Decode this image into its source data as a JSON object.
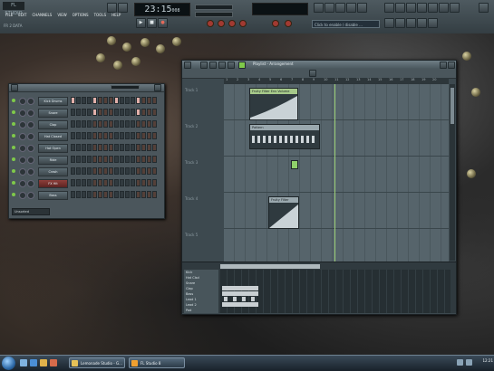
{
  "topbar": {
    "logo": "FL STUDIO",
    "menu": [
      "FILE",
      "EDIT",
      "CHANNELS",
      "VIEW",
      "OPTIONS",
      "TOOLS",
      "HELP"
    ],
    "hint": "FR 2 DATA",
    "clock": "23:15",
    "clock_sub": "008",
    "hint_bar": "Click to enable / disable ...",
    "transport": {
      "play": "▶",
      "stop": "■",
      "record": "●"
    }
  },
  "stepseq": {
    "channels": [
      {
        "name": "Kick Drums",
        "red": false,
        "steps": [
          1,
          0,
          0,
          0,
          1,
          0,
          0,
          0,
          1,
          0,
          0,
          0,
          1,
          0,
          0,
          0
        ]
      },
      {
        "name": "Snare",
        "red": false,
        "steps": [
          0,
          0,
          0,
          0,
          1,
          0,
          0,
          0,
          0,
          0,
          0,
          0,
          1,
          0,
          0,
          0
        ]
      },
      {
        "name": "Clap",
        "red": false,
        "steps": [
          0,
          0,
          0,
          0,
          0,
          0,
          0,
          0,
          0,
          0,
          0,
          0,
          0,
          0,
          0,
          0
        ]
      },
      {
        "name": "Hat Closed",
        "red": false,
        "steps": [
          0,
          0,
          0,
          0,
          0,
          0,
          0,
          0,
          0,
          0,
          0,
          0,
          0,
          0,
          0,
          0
        ]
      },
      {
        "name": "Hat Open",
        "red": false,
        "steps": [
          0,
          0,
          0,
          0,
          0,
          0,
          0,
          0,
          0,
          0,
          0,
          0,
          0,
          0,
          0,
          0
        ]
      },
      {
        "name": "Ride",
        "red": false,
        "steps": [
          0,
          0,
          0,
          0,
          0,
          0,
          0,
          0,
          0,
          0,
          0,
          0,
          0,
          0,
          0,
          0
        ]
      },
      {
        "name": "Crash",
        "red": false,
        "steps": [
          0,
          0,
          0,
          0,
          0,
          0,
          0,
          0,
          0,
          0,
          0,
          0,
          0,
          0,
          0,
          0
        ]
      },
      {
        "name": "FX Hit",
        "red": true,
        "steps": [
          0,
          0,
          0,
          0,
          0,
          0,
          0,
          0,
          0,
          0,
          0,
          0,
          0,
          0,
          0,
          0
        ]
      },
      {
        "name": "Bass",
        "red": false,
        "steps": [
          0,
          0,
          0,
          0,
          0,
          0,
          0,
          0,
          0,
          0,
          0,
          0,
          0,
          0,
          0,
          0
        ]
      }
    ],
    "footer": "Unsorted"
  },
  "playlist": {
    "title": "Playlist - Arrangement",
    "ruler": [
      "1",
      "2",
      "3",
      "4",
      "5",
      "6",
      "7",
      "8",
      "9",
      "10",
      "11",
      "12",
      "13",
      "14",
      "15",
      "16",
      "17",
      "18",
      "19",
      "20"
    ],
    "tracks": [
      "Track 1",
      "Track 2",
      "Track 3",
      "Track 4",
      "Track 5"
    ],
    "clips": [
      {
        "label": "Fruity Filter Env Volume",
        "track": 0
      },
      {
        "label": "Pattern",
        "track": 1
      },
      {
        "label": "",
        "track": 2
      },
      {
        "label": "Fruity Filter",
        "track": 3
      }
    ],
    "pianoroll_rows": [
      "Kick",
      "Hat Clsd",
      "Snare",
      "Clap",
      "Bass",
      "Lead 1",
      "Lead 2",
      "Pad"
    ]
  },
  "taskbar": {
    "tasks": [
      "Lemonade Studio - G...",
      "FL Studio 8"
    ],
    "clock": "12:21"
  }
}
